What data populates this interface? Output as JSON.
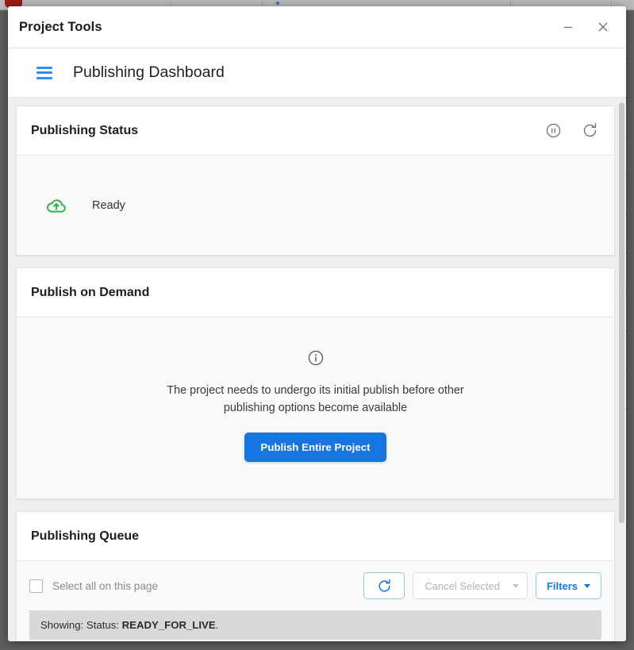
{
  "window": {
    "title": "Project Tools",
    "minimize_label": "minimize",
    "close_label": "close"
  },
  "app_header": {
    "menu_icon": "hamburger-menu-icon",
    "page_title": "Publishing Dashboard"
  },
  "cards": {
    "publishing_status": {
      "title": "Publishing Status",
      "pause_icon": "pause-circle-icon",
      "refresh_icon": "refresh-icon",
      "status_icon": "cloud-upload-icon",
      "status_text": "Ready",
      "status_color": "#2eb34a"
    },
    "publish_on_demand": {
      "title": "Publish on Demand",
      "info_icon": "info-circle-icon",
      "message": "The project needs to undergo its initial publish before other publishing options become available",
      "primary_button": "Publish Entire Project",
      "primary_button_color": "#1675e0"
    },
    "publishing_queue": {
      "title": "Publishing Queue",
      "select_all_label": "Select all on this page",
      "refresh_icon": "refresh-icon",
      "cancel_selected_label": "Cancel Selected",
      "cancel_selected_caret": "chevron-down-icon",
      "filters_label": "Filters",
      "filters_caret": "caret-down-icon",
      "showing_prefix": "Showing: Status: ",
      "showing_status": "READY_FOR_LIVE",
      "showing_suffix": "."
    }
  },
  "background": {
    "chevron": "›"
  }
}
